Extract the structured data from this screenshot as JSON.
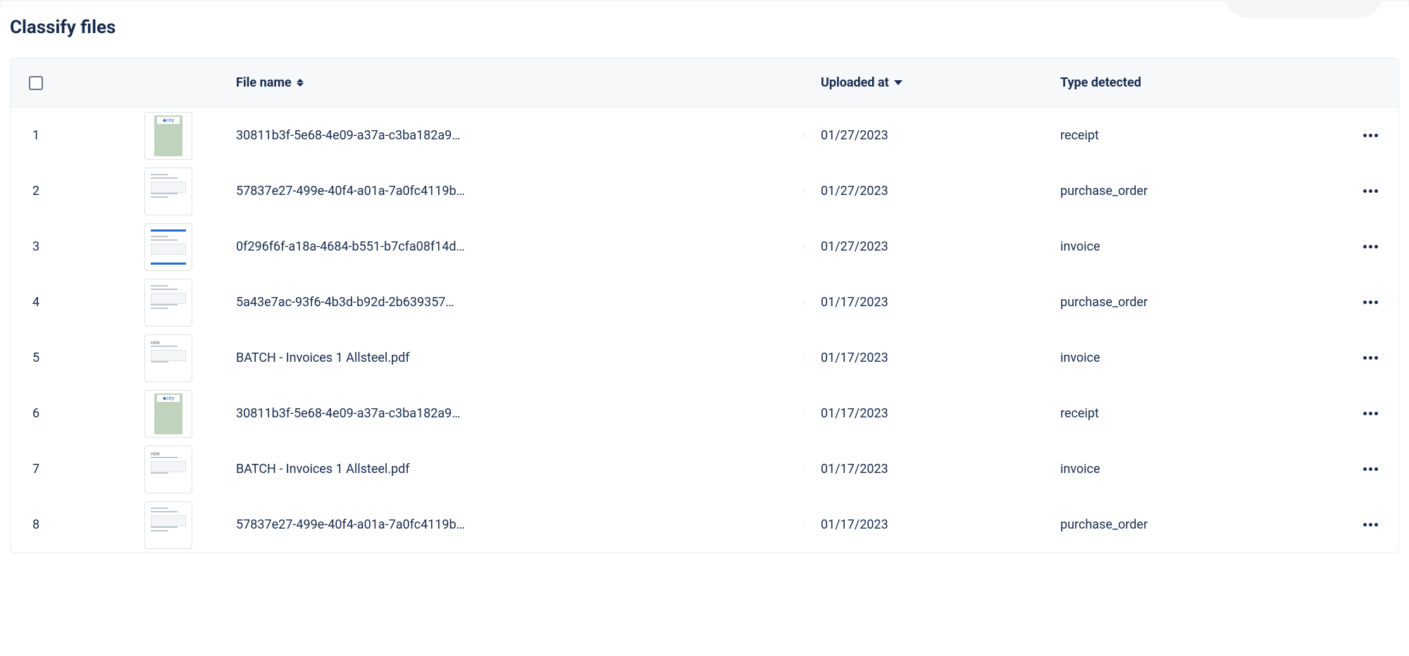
{
  "page": {
    "title": "Classify files"
  },
  "columns": {
    "file_name": "File name",
    "uploaded_at": "Uploaded at",
    "type_detected": "Type detected"
  },
  "rows": [
    {
      "index": "1",
      "file_name": "30811b3f-5e68-4e09-a37a-c3ba182a9…",
      "uploaded_at": "01/27/2023",
      "type_detected": "receipt",
      "thumb": "receipt"
    },
    {
      "index": "2",
      "file_name": "57837e27-499e-40f4-a01a-7a0fc4119b…",
      "uploaded_at": "01/27/2023",
      "type_detected": "purchase_order",
      "thumb": "po"
    },
    {
      "index": "3",
      "file_name": "0f296f6f-a18a-4684-b551-b7cfa08f14d…",
      "uploaded_at": "01/27/2023",
      "type_detected": "invoice",
      "thumb": "invoice"
    },
    {
      "index": "4",
      "file_name": "5a43e7ac-93f6-4b3d-b92d-2b639357…",
      "uploaded_at": "01/17/2023",
      "type_detected": "purchase_order",
      "thumb": "po"
    },
    {
      "index": "5",
      "file_name": "BATCH - Invoices 1 Allsteel.pdf",
      "uploaded_at": "01/17/2023",
      "type_detected": "invoice",
      "thumb": "batch"
    },
    {
      "index": "6",
      "file_name": "30811b3f-5e68-4e09-a37a-c3ba182a9…",
      "uploaded_at": "01/17/2023",
      "type_detected": "receipt",
      "thumb": "receipt"
    },
    {
      "index": "7",
      "file_name": "BATCH - Invoices 1 Allsteel.pdf",
      "uploaded_at": "01/17/2023",
      "type_detected": "invoice",
      "thumb": "batch"
    },
    {
      "index": "8",
      "file_name": "57837e27-499e-40f4-a01a-7a0fc4119b…",
      "uploaded_at": "01/17/2023",
      "type_detected": "purchase_order",
      "thumb": "po"
    }
  ]
}
